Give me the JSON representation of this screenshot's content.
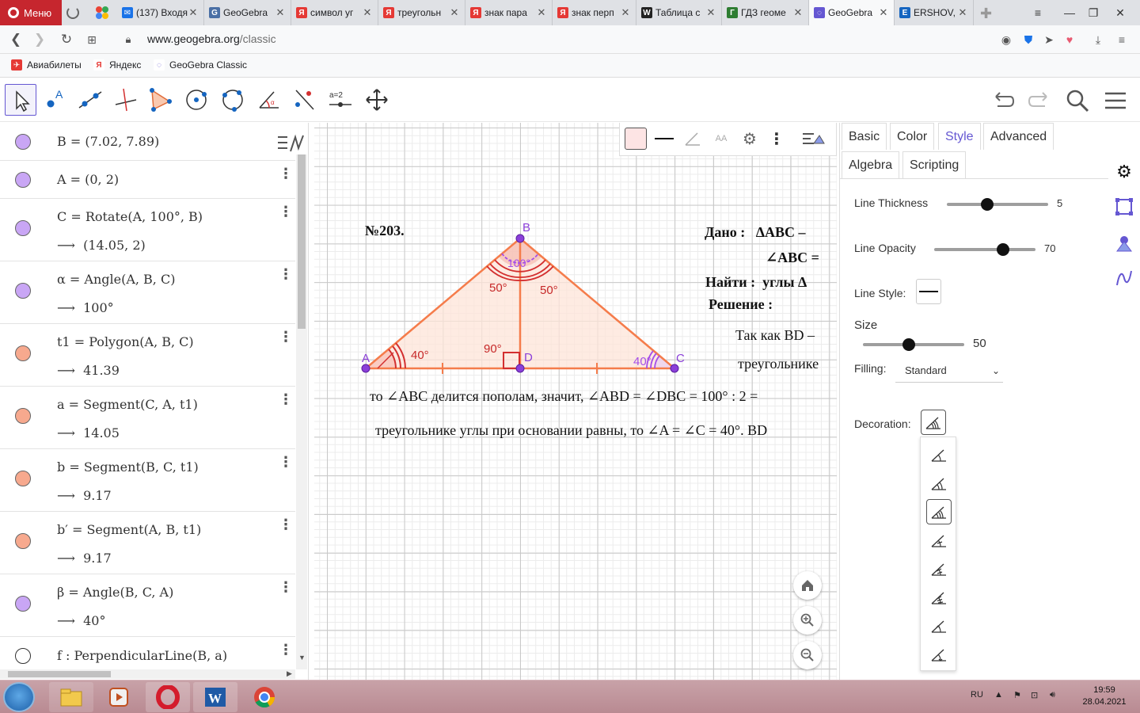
{
  "browser": {
    "menu_label": "Меню",
    "tabs": [
      {
        "title": "(137) Входя",
        "fav_color": "#1a73e8",
        "fav_text": "✉"
      },
      {
        "title": "GeoGebra",
        "fav_color": "#4a6fa5",
        "fav_text": "G"
      },
      {
        "title": "символ уг",
        "fav_color": "#e53935",
        "fav_text": "Я"
      },
      {
        "title": "треугольн",
        "fav_color": "#e53935",
        "fav_text": "Я"
      },
      {
        "title": "знак пара",
        "fav_color": "#e53935",
        "fav_text": "Я"
      },
      {
        "title": "знак перп",
        "fav_color": "#e53935",
        "fav_text": "Я"
      },
      {
        "title": "Таблица с",
        "fav_color": "#222222",
        "fav_text": "W"
      },
      {
        "title": "ГДЗ геоме",
        "fav_color": "#2e7d32",
        "fav_text": "Г"
      },
      {
        "title": "GeoGebra",
        "fav_color": "#6557d2",
        "fav_text": "◌"
      },
      {
        "title": "ERSHOV, I",
        "fav_color": "#1565c0",
        "fav_text": "E"
      }
    ],
    "url_host": "www.geogebra.org",
    "url_path": "/classic",
    "bookmarks": [
      {
        "label": "Авиабилеты",
        "color": "#e53935",
        "icon": "✈"
      },
      {
        "label": "Яндекс",
        "color": "#e53935",
        "icon": "Я"
      },
      {
        "label": "GeoGebra Classic",
        "color": "#6557d2",
        "icon": "◌"
      }
    ]
  },
  "toolbar": {
    "tools": [
      "move-tool",
      "point-tool",
      "line-tool",
      "perpendicular-line-tool",
      "polygon-tool",
      "circle-center-tool",
      "circle-three-points-tool",
      "angle-tool",
      "reflect-tool",
      "slider-tool",
      "move-graphics-tool"
    ],
    "slider_tool_label": "a = 2"
  },
  "algebra": {
    "rows": [
      {
        "input": "B = (7.02, 7.89)",
        "output": "",
        "color": "#c9a6f5"
      },
      {
        "input": "A = (0, 2)",
        "output": "",
        "color": "#c9a6f5"
      },
      {
        "input": "C = Rotate(A, 100°, B)",
        "output": "(14.05, 2)",
        "color": "#c9a6f5"
      },
      {
        "input": "α = Angle(A, B, C)",
        "output": "100°",
        "color": "#c9a6f5"
      },
      {
        "input": "t1 = Polygon(A, B, C)",
        "output": "41.39",
        "color": "#f7a98e"
      },
      {
        "input": "a = Segment(C, A, t1)",
        "output": "14.05",
        "color": "#f7a98e"
      },
      {
        "input": "b = Segment(B, C, t1)",
        "output": "9.17",
        "color": "#f7a98e"
      },
      {
        "input": "b′ = Segment(A, B, t1)",
        "output": "9.17",
        "color": "#f7a98e"
      },
      {
        "input": "β = Angle(B, C, A)",
        "output": "40°",
        "color": "#c9a6f5"
      },
      {
        "input": "f : PerpendicularLine(B, a)",
        "output": "",
        "color": "#ffffff"
      }
    ],
    "output_arrow": "⟶"
  },
  "graphics": {
    "problem_number": "№203.",
    "given_label": "Дано :",
    "given_text": "ΔABC –",
    "given_text2": "∠ABC =",
    "find_label": "Найти :",
    "find_text": "углы  Δ",
    "solution_label": "Решение :",
    "line1": "Так как BD –",
    "line2": "треугольнике",
    "line3": "то  ∠ABC делится пополам,  значит,   ∠ABD =  ∠DBC = 100° : 2 =",
    "line4": "треугольнике углы при основании равны,  то  ∠A =  ∠C = 40°. BD",
    "points": {
      "A": "A",
      "B": "B",
      "C": "C",
      "D": "D"
    },
    "angle_labels": {
      "apex": "100°",
      "left_half": "50°",
      "right_half": "50°",
      "base_left": "40°",
      "base_right": "40°",
      "right": "90°"
    },
    "colors": {
      "triangle": "#f57c4b",
      "fill": "#fde4d8",
      "point": "#8b3fd9",
      "angle_red": "#d32f2f",
      "angle_purple": "#a64ee8"
    }
  },
  "properties": {
    "tabs_row1": [
      "Basic",
      "Color",
      "Style",
      "Advanced"
    ],
    "tabs_row2": [
      "Algebra",
      "Scripting"
    ],
    "active_tab": "Style",
    "line_thickness_label": "Line Thickness",
    "line_thickness_value": "5",
    "line_thickness_frac": 0.4,
    "line_opacity_label": "Line Opacity",
    "line_opacity_value": "70",
    "line_opacity_frac": 0.68,
    "line_style_label": "Line Style:",
    "size_label": "Size",
    "size_value": "50",
    "size_frac": 0.45,
    "filling_label": "Filling:",
    "filling_value": "Standard",
    "decoration_label": "Decoration:",
    "accent": "#6557d2"
  },
  "taskbar": {
    "lang": "RU",
    "time": "19:59",
    "date": "28.04.2021"
  }
}
